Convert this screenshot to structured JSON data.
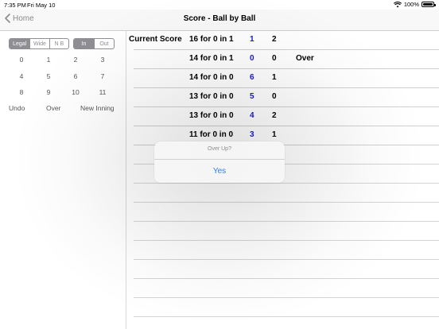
{
  "status_bar": {
    "time": "7:35 PM",
    "date": "Fri May 10",
    "battery": "100%"
  },
  "nav": {
    "back_label": "Home",
    "title": "Score - Ball by Ball"
  },
  "ball_type_segment": {
    "options": [
      "Legal",
      "Wide",
      "N B"
    ],
    "selected": "Legal"
  },
  "out_segment": {
    "options": [
      "In",
      "Out"
    ],
    "selected": "In"
  },
  "keypad": {
    "keys": [
      "0",
      "1",
      "2",
      "3",
      "4",
      "5",
      "6",
      "7",
      "8",
      "9",
      "10",
      "11"
    ]
  },
  "actions": {
    "undo": "Undo",
    "over": "Over",
    "new_inning": "New Inning"
  },
  "score_rows": [
    {
      "label": "Current Score",
      "score": "16 for 0 in 1",
      "runs": "1",
      "balls": "2",
      "note": ""
    },
    {
      "label": "",
      "score": "14 for 0 in 1",
      "runs": "0",
      "balls": "0",
      "note": "Over"
    },
    {
      "label": "",
      "score": "14 for 0 in 0",
      "runs": "6",
      "balls": "1",
      "note": ""
    },
    {
      "label": "",
      "score": "13 for 0 in 0",
      "runs": "5",
      "balls": "0",
      "note": ""
    },
    {
      "label": "",
      "score": "13 for 0 in 0",
      "runs": "4",
      "balls": "2",
      "note": ""
    },
    {
      "label": "",
      "score": "11 for 0 in 0",
      "runs": "3",
      "balls": "1",
      "note": ""
    }
  ],
  "alert": {
    "title": "Over Up?",
    "confirm": "Yes"
  },
  "colors": {
    "accent": "#2f7cf6",
    "runs_blue": "#1a1acc",
    "segment_gray": "#8e8e93"
  }
}
